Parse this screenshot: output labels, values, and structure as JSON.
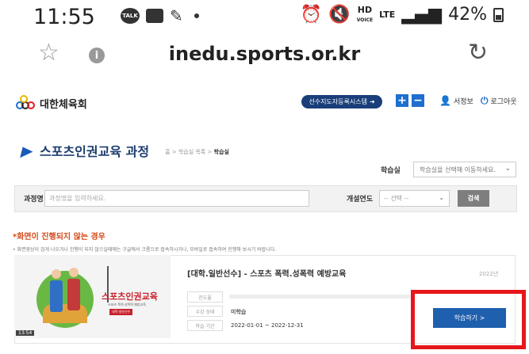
{
  "status_bar": {
    "time": "11:55",
    "talk_label": "TALK",
    "hd_label": "HD",
    "voice_label": "VOICE",
    "lte_label": "LTE",
    "battery": "42%"
  },
  "browser": {
    "url": "inedu.sports.or.kr",
    "star_icon": "star-outline-icon",
    "info_icon": "info-icon",
    "reload_icon": "reload-icon"
  },
  "header": {
    "logo_text": "대한체육회",
    "system_button": "선수지도자등록시스템",
    "plus": "+",
    "minus": "−",
    "user_name": "서정보",
    "logout": "로그아웃"
  },
  "page": {
    "title": "스포츠인권교육 과정",
    "breadcrumb_prefix": "홈 > 학습실 목록 > ",
    "breadcrumb_current": "학습실"
  },
  "classroom": {
    "label": "학습실",
    "placeholder": "학습실을 선택해 이동하세요."
  },
  "search": {
    "course_label": "과정명",
    "course_placeholder": "과정명을 입력하세요.",
    "year_label": "개설연도",
    "year_placeholder": "-- 선택 --",
    "button": "검색"
  },
  "notice": {
    "title": "*화면이 진행되지 않는 경우",
    "text": "• 화면영상이 검게 나오거나 진행이 되지 않으실때에는 구글에서 크롬으로 접속하시거나, 모바일로 접속하여 진행해 보시기 바랍니다."
  },
  "course": {
    "title": "[대학.일반선수] - 스포츠 폭력.성폭력 예방교육",
    "year": "2022년",
    "progress_label": "진도율",
    "progress_value": 0,
    "status_label": "수강 상태",
    "status_value": "미학습",
    "period_label": "학습 기간",
    "period_value": "2022-01-01 ~ 2022-12-31",
    "thumb_title": "스포츠인권교육",
    "thumb_subtitle": "스포츠 폭력·성폭력 예방교육",
    "thumb_tag": "대학·일반선수",
    "thumb_time": "13:54",
    "study_button": "학습하기 >"
  },
  "colors": {
    "accent": "#1e5fae",
    "highlight": "#e6171b",
    "notice": "#d74a1a"
  }
}
